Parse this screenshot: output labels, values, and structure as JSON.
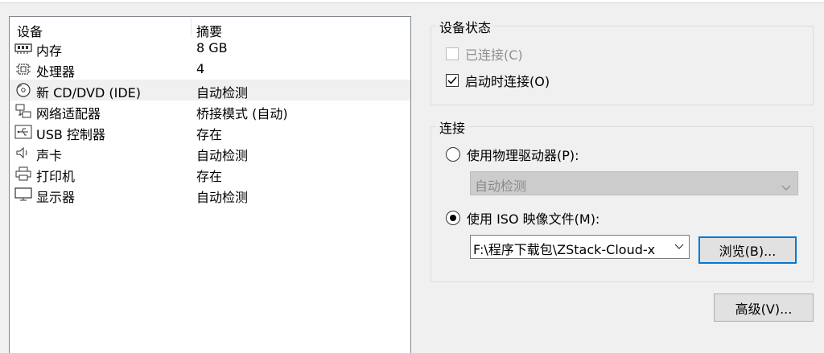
{
  "device_list": {
    "columns": {
      "device": "设备",
      "summary": "摘要"
    },
    "rows": [
      {
        "name": "内存",
        "summary": "8 GB",
        "icon": "memory-icon"
      },
      {
        "name": "处理器",
        "summary": "4",
        "icon": "processor-icon"
      },
      {
        "name": "新 CD/DVD (IDE)",
        "summary": "自动检测",
        "icon": "cd-dvd-icon",
        "selected": true
      },
      {
        "name": "网络适配器",
        "summary": "桥接模式 (自动)",
        "icon": "network-adapter-icon"
      },
      {
        "name": "USB 控制器",
        "summary": "存在",
        "icon": "usb-icon"
      },
      {
        "name": "声卡",
        "summary": "自动检测",
        "icon": "sound-card-icon"
      },
      {
        "name": "打印机",
        "summary": "存在",
        "icon": "printer-icon"
      },
      {
        "name": "显示器",
        "summary": "自动检测",
        "icon": "display-icon"
      }
    ]
  },
  "device_status": {
    "title": "设备状态",
    "connected_label": "已连接(C)",
    "connected_checked": false,
    "connected_enabled": false,
    "connect_at_power_on_label": "启动时连接(O)",
    "connect_at_power_on_checked": true
  },
  "connection": {
    "title": "连接",
    "physical_drive_label": "使用物理驱动器(P):",
    "physical_drive_selected": false,
    "physical_drive_value": "自动检测",
    "iso_label": "使用 ISO 映像文件(M):",
    "iso_selected": true,
    "iso_path": "F:\\程序下载包\\ZStack-Cloud-x",
    "browse_label": "浏览(B)..."
  },
  "advanced_label": "高级(V)...",
  "colors": {
    "border": "#828790",
    "focus": "#0078d7",
    "disabled": "#cccccc"
  }
}
